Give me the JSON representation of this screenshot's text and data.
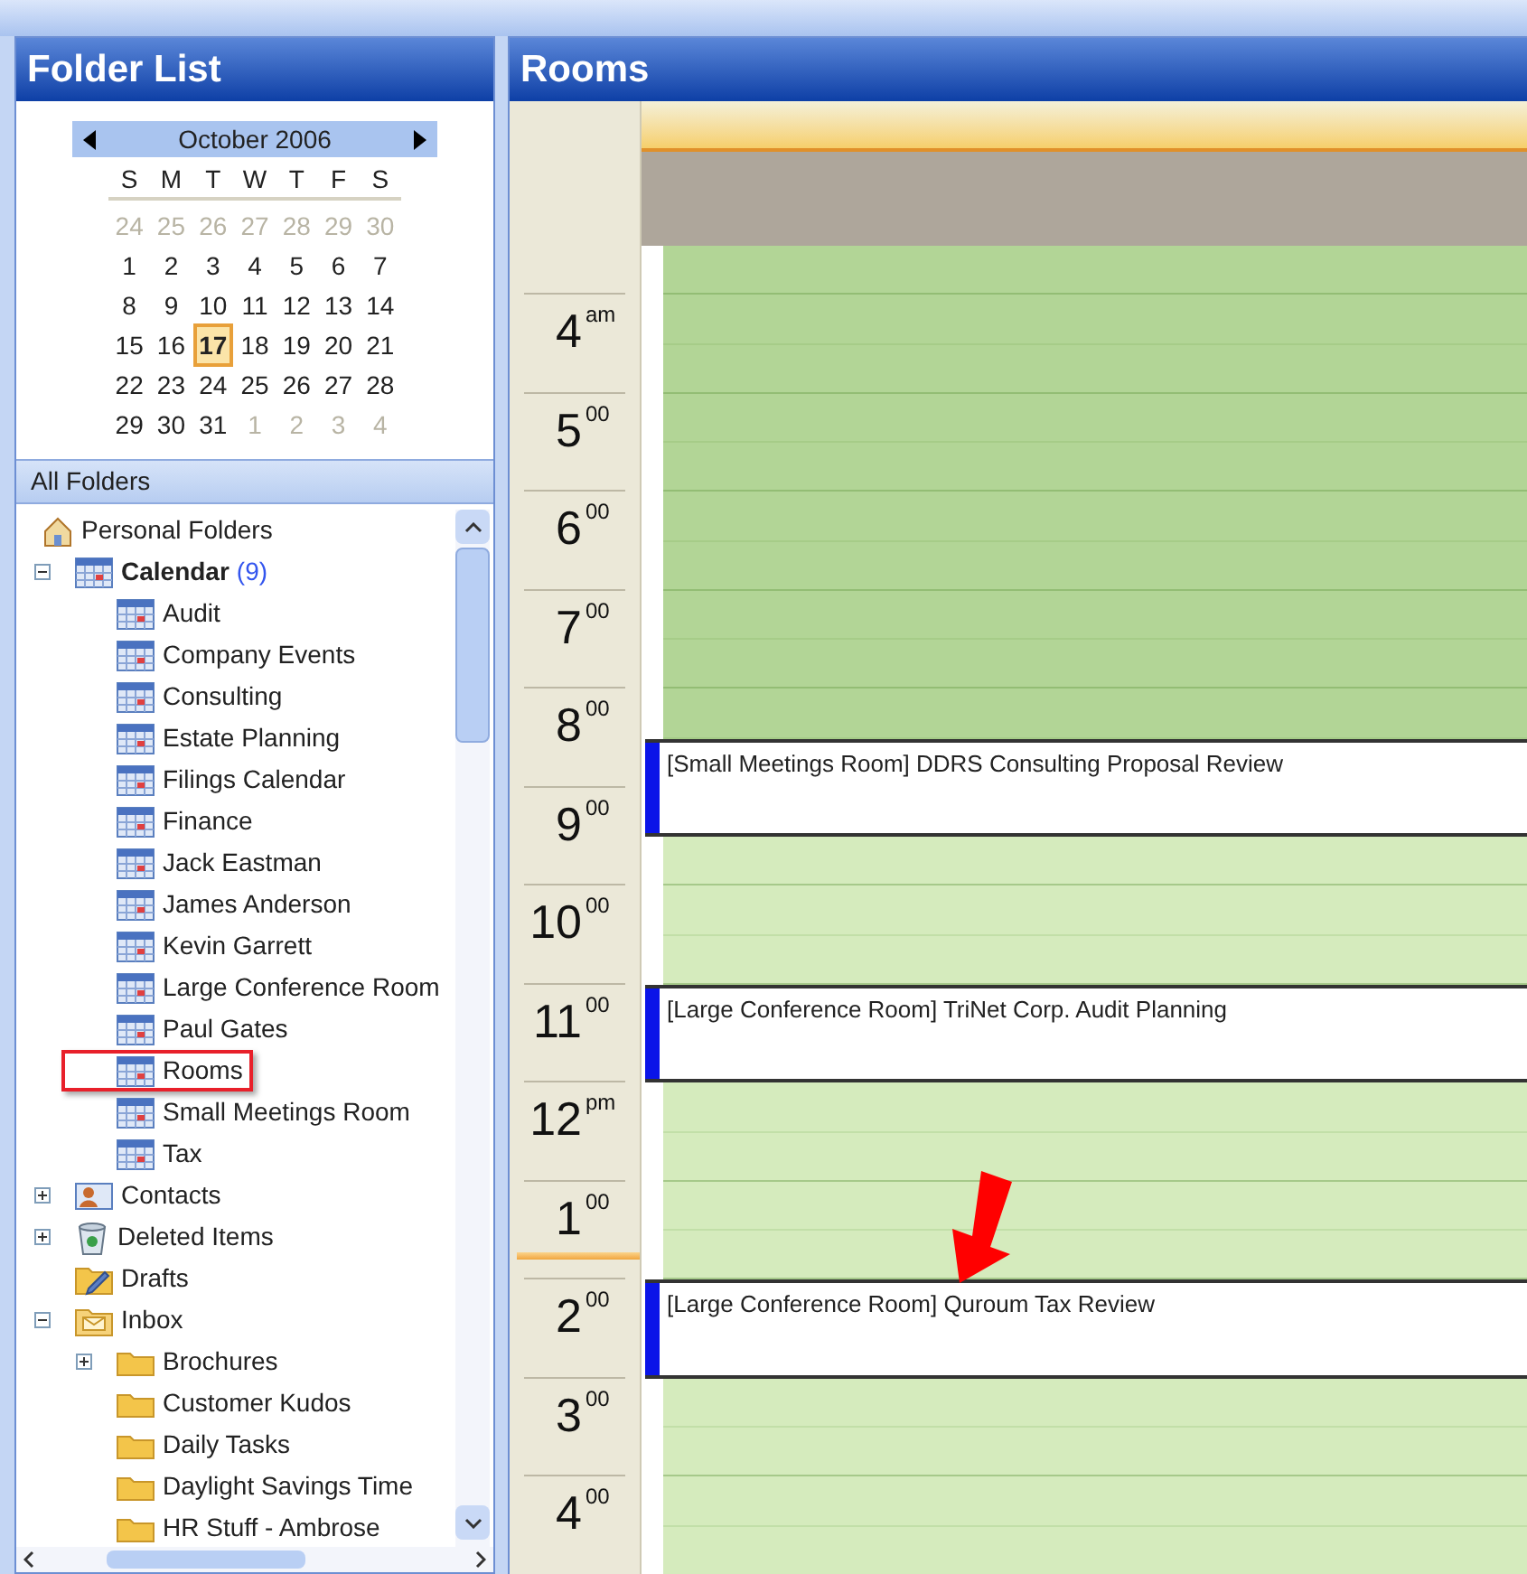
{
  "folder_pane": {
    "title": "Folder List",
    "month": {
      "label": "October 2006",
      "weekdays": [
        "S",
        "M",
        "T",
        "W",
        "T",
        "F",
        "S"
      ],
      "weeks": [
        [
          {
            "d": "24",
            "other": true,
            "today": false
          },
          {
            "d": "25",
            "other": true,
            "today": false
          },
          {
            "d": "26",
            "other": true,
            "today": false
          },
          {
            "d": "27",
            "other": true,
            "today": false
          },
          {
            "d": "28",
            "other": true,
            "today": false
          },
          {
            "d": "29",
            "other": true,
            "today": false
          },
          {
            "d": "30",
            "other": true,
            "today": false
          }
        ],
        [
          {
            "d": "1",
            "other": false,
            "today": false
          },
          {
            "d": "2",
            "other": false,
            "today": false
          },
          {
            "d": "3",
            "other": false,
            "today": false
          },
          {
            "d": "4",
            "other": false,
            "today": false
          },
          {
            "d": "5",
            "other": false,
            "today": false
          },
          {
            "d": "6",
            "other": false,
            "today": false
          },
          {
            "d": "7",
            "other": false,
            "today": false
          }
        ],
        [
          {
            "d": "8",
            "other": false,
            "today": false
          },
          {
            "d": "9",
            "other": false,
            "today": false
          },
          {
            "d": "10",
            "other": false,
            "today": false
          },
          {
            "d": "11",
            "other": false,
            "today": false
          },
          {
            "d": "12",
            "other": false,
            "today": false
          },
          {
            "d": "13",
            "other": false,
            "today": false
          },
          {
            "d": "14",
            "other": false,
            "today": false
          }
        ],
        [
          {
            "d": "15",
            "other": false,
            "today": false
          },
          {
            "d": "16",
            "other": false,
            "today": false
          },
          {
            "d": "17",
            "other": false,
            "today": true
          },
          {
            "d": "18",
            "other": false,
            "today": false
          },
          {
            "d": "19",
            "other": false,
            "today": false
          },
          {
            "d": "20",
            "other": false,
            "today": false
          },
          {
            "d": "21",
            "other": false,
            "today": false
          }
        ],
        [
          {
            "d": "22",
            "other": false,
            "today": false
          },
          {
            "d": "23",
            "other": false,
            "today": false
          },
          {
            "d": "24",
            "other": false,
            "today": false
          },
          {
            "d": "25",
            "other": false,
            "today": false
          },
          {
            "d": "26",
            "other": false,
            "today": false
          },
          {
            "d": "27",
            "other": false,
            "today": false
          },
          {
            "d": "28",
            "other": false,
            "today": false
          }
        ],
        [
          {
            "d": "29",
            "other": false,
            "today": false
          },
          {
            "d": "30",
            "other": false,
            "today": false
          },
          {
            "d": "31",
            "other": false,
            "today": false
          },
          {
            "d": "1",
            "other": true,
            "today": false
          },
          {
            "d": "2",
            "other": true,
            "today": false
          },
          {
            "d": "3",
            "other": true,
            "today": false
          },
          {
            "d": "4",
            "other": true,
            "today": false
          }
        ]
      ]
    },
    "section": "All Folders",
    "tree": [
      {
        "label": "Personal Folders",
        "kind": "personal",
        "children": [
          {
            "label": "Calendar",
            "kind": "calendar",
            "count": "(9)",
            "expanded": true,
            "children": [
              {
                "label": "Audit",
                "kind": "calendar",
                "highlighted": false
              },
              {
                "label": "Company Events",
                "kind": "calendar",
                "highlighted": false
              },
              {
                "label": "Consulting",
                "kind": "calendar",
                "highlighted": false
              },
              {
                "label": "Estate Planning",
                "kind": "calendar",
                "highlighted": false
              },
              {
                "label": "Filings Calendar",
                "kind": "calendar",
                "highlighted": false
              },
              {
                "label": "Finance",
                "kind": "calendar",
                "highlighted": false
              },
              {
                "label": "Jack Eastman",
                "kind": "calendar",
                "highlighted": false
              },
              {
                "label": "James Anderson",
                "kind": "calendar",
                "highlighted": false
              },
              {
                "label": "Kevin Garrett",
                "kind": "calendar",
                "highlighted": false
              },
              {
                "label": "Large Conference Room",
                "kind": "calendar",
                "highlighted": false
              },
              {
                "label": "Paul Gates",
                "kind": "calendar",
                "highlighted": false
              },
              {
                "label": "Rooms",
                "kind": "calendar",
                "highlighted": true
              },
              {
                "label": "Small Meetings Room",
                "kind": "calendar",
                "highlighted": false
              },
              {
                "label": "Tax",
                "kind": "calendar",
                "highlighted": false
              }
            ]
          },
          {
            "label": "Contacts",
            "kind": "contacts",
            "expanded": false
          },
          {
            "label": "Deleted Items",
            "kind": "trash",
            "expanded": false
          },
          {
            "label": "Drafts",
            "kind": "drafts"
          },
          {
            "label": "Inbox",
            "kind": "inbox",
            "expanded": true,
            "children": [
              {
                "label": "Brochures",
                "kind": "folder",
                "expanded": false
              },
              {
                "label": "Customer Kudos",
                "kind": "folder"
              },
              {
                "label": "Daily Tasks",
                "kind": "folder"
              },
              {
                "label": "Daylight Savings Time",
                "kind": "folder"
              },
              {
                "label": "HR Stuff - Ambrose",
                "kind": "folder"
              }
            ]
          }
        ]
      }
    ]
  },
  "calendar_pane": {
    "title": "Rooms",
    "hours": [
      {
        "hour": "4",
        "suffix": "am",
        "now": false
      },
      {
        "hour": "5",
        "suffix": "00",
        "now": false
      },
      {
        "hour": "6",
        "suffix": "00",
        "now": false
      },
      {
        "hour": "7",
        "suffix": "00",
        "now": false
      },
      {
        "hour": "8",
        "suffix": "00",
        "now": false
      },
      {
        "hour": "9",
        "suffix": "00",
        "now": false
      },
      {
        "hour": "10",
        "suffix": "00",
        "now": false
      },
      {
        "hour": "11",
        "suffix": "00",
        "now": false
      },
      {
        "hour": "12",
        "suffix": "pm",
        "now": false
      },
      {
        "hour": "1",
        "suffix": "00",
        "now": true
      },
      {
        "hour": "2",
        "suffix": "00",
        "now": false
      },
      {
        "hour": "3",
        "suffix": "00",
        "now": false
      },
      {
        "hour": "4",
        "suffix": "00",
        "now": false
      }
    ],
    "rows": [
      {
        "kind": "slot",
        "working": false
      },
      {
        "kind": "slot",
        "working": false
      },
      {
        "kind": "slot",
        "working": false
      },
      {
        "kind": "slot",
        "working": false
      },
      {
        "kind": "slot",
        "working": false
      },
      {
        "kind": "slot",
        "working": false
      },
      {
        "kind": "slot",
        "working": false
      },
      {
        "kind": "slot",
        "working": false
      },
      {
        "kind": "slot",
        "working": false
      },
      {
        "kind": "slot",
        "working": false
      },
      {
        "kind": "appointment",
        "text": "[Small Meetings Room] DDRS Consulting Proposal Review",
        "arrow": false
      },
      {
        "kind": "slot",
        "working": true
      },
      {
        "kind": "slot",
        "working": true
      },
      {
        "kind": "slot",
        "working": true
      },
      {
        "kind": "appointment",
        "text": "[Large Conference Room] TriNet Corp. Audit Planning",
        "arrow": false
      },
      {
        "kind": "slot",
        "working": true
      },
      {
        "kind": "slot",
        "working": true
      },
      {
        "kind": "slot",
        "working": true
      },
      {
        "kind": "slot",
        "working": true
      },
      {
        "kind": "appointment",
        "text": "[Large Conference Room] Quroum Tax Review",
        "arrow": true
      },
      {
        "kind": "slot",
        "working": true
      },
      {
        "kind": "slot",
        "working": true
      },
      {
        "kind": "slot",
        "working": true
      },
      {
        "kind": "slot",
        "working": true
      }
    ]
  }
}
